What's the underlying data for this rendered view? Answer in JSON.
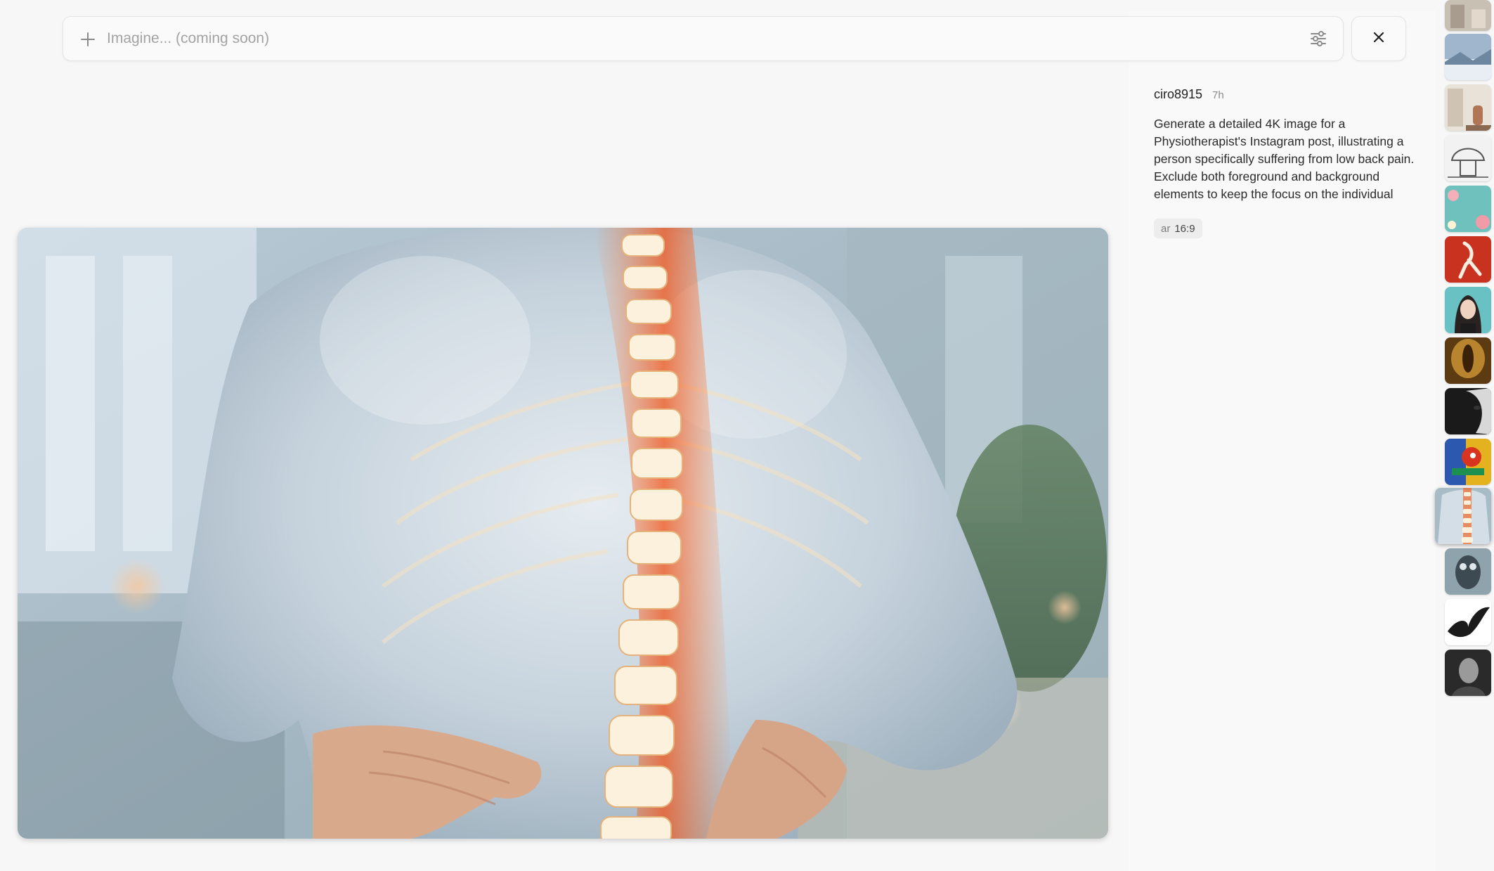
{
  "search": {
    "placeholder": "Imagine... (coming soon)"
  },
  "icons": {
    "add": "plus-icon",
    "filters": "sliders-icon",
    "close": "close-icon"
  },
  "detail": {
    "author": "ciro8915",
    "time": "7h",
    "prompt": "Generate a detailed 4K image for a Physiotherapist's Instagram post, illustrating a person specifically suffering from low back pain. Exclude both foreground and background elements to keep the focus on the individual",
    "param": {
      "key": "ar",
      "value": "16:9"
    }
  },
  "thumbnails": [
    {
      "subject": "room-interior",
      "selected": false
    },
    {
      "subject": "snowy-landscape",
      "selected": false
    },
    {
      "subject": "interior-vase",
      "selected": false
    },
    {
      "subject": "mushroom-house-sketch",
      "selected": false
    },
    {
      "subject": "teal-floral",
      "selected": false
    },
    {
      "subject": "red-figure-illustration",
      "selected": false
    },
    {
      "subject": "portrait-woman",
      "selected": false
    },
    {
      "subject": "golden-figure",
      "selected": false
    },
    {
      "subject": "bw-face",
      "selected": false
    },
    {
      "subject": "colorful-dragon-mural",
      "selected": false
    },
    {
      "subject": "back-pain-spine",
      "selected": true
    },
    {
      "subject": "owl-painting",
      "selected": false
    },
    {
      "subject": "black-bird",
      "selected": false
    },
    {
      "subject": "bw-portrait",
      "selected": false
    }
  ]
}
